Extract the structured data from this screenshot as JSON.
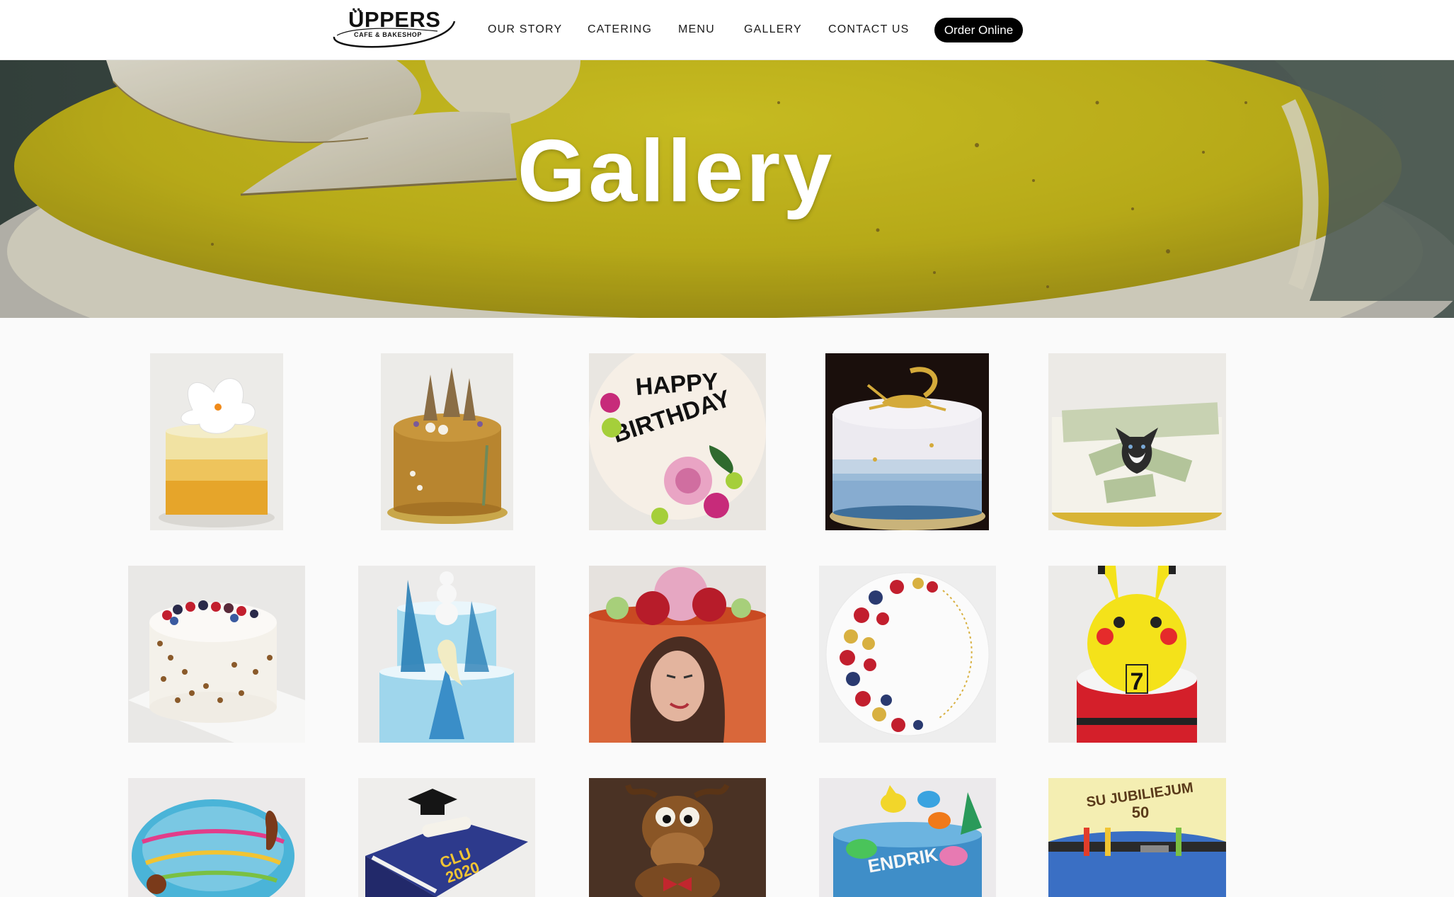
{
  "header": {
    "logo": {
      "name": "ÜPPERS",
      "tagline": "CAFE & BAKESHOP"
    },
    "nav": [
      {
        "label": "OUR STORY"
      },
      {
        "label": "CATERING"
      },
      {
        "label": "MENU"
      },
      {
        "label": "GALLERY"
      },
      {
        "label": "CONTACT US"
      }
    ],
    "order_button": "Order Online"
  },
  "hero": {
    "title": "Gallery"
  },
  "gallery": {
    "rows": [
      [
        "white-flower-yellow-ombre-cake",
        "honey-cake-with-pine-trees",
        "happy-birthday-floral-cake",
        "gold-scorpion-cake",
        "money-husky-cake"
      ],
      [
        "berry-coconut-cake",
        "frozen-elsa-olaf-cake",
        "photo-floral-portrait-cake",
        "berry-crescent-cake",
        "pikachu-pokeball-cake"
      ],
      [
        "easter-egg-cake",
        "graduation-book-cake",
        "reindeer-cake",
        "baby-shark-cake",
        "jeans-50th-jubilee-cake"
      ]
    ]
  },
  "colors": {
    "hero_yellow": "#d8c81e",
    "button_bg": "#000000",
    "page_bg": "#fafafa"
  }
}
